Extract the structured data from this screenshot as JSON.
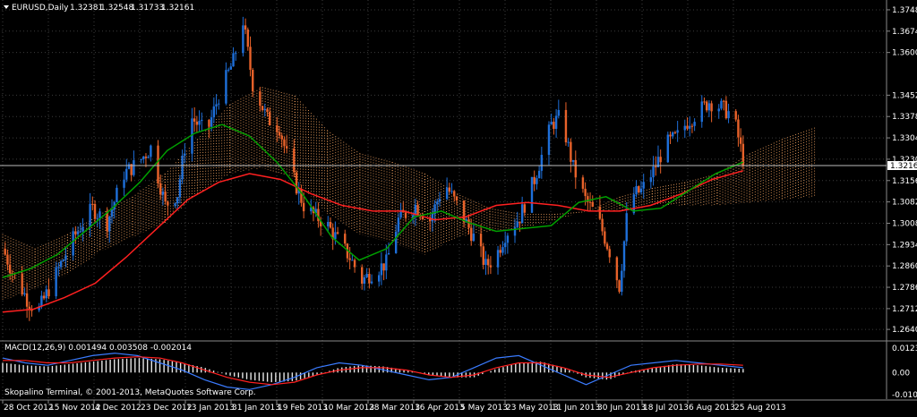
{
  "window": {
    "title": "EURUSD,Daily",
    "ohlc": [
      "1.32381",
      "1.32548",
      "1.31733",
      "1.32161"
    ],
    "current_price": "1.32161"
  },
  "indicator": {
    "title": "MACD(12,26,9) 0.001494 0.003508 -0.002014",
    "copyright": "Skopalino Terminal, © 2001-2013, MetaQuotes Software Corp."
  },
  "colors": {
    "background": "#000000",
    "bull": "#1e6fd9",
    "bear": "#e8622a",
    "ma_fast": "#00a000",
    "ma_slow": "#ff2020",
    "cloud": "#f4a460",
    "macd_main": "#3a7bff",
    "macd_signal": "#ff2020",
    "grid": "#3c3c3c"
  },
  "chart_data": {
    "type": "candlestick",
    "symbol": "EURUSD",
    "timeframe": "Daily",
    "price_axis": {
      "ylim": [
        1.26,
        1.3782
      ],
      "ticks": [
        "1.37480",
        "1.36740",
        "1.36000",
        "1.34520",
        "1.33780",
        "1.33040",
        "1.32300",
        "1.31560",
        "1.30820",
        "1.30080",
        "1.29340",
        "1.28600",
        "1.27860",
        "1.27120",
        "1.26400"
      ]
    },
    "x_labels": [
      "28 Oct 2012",
      "15 Nov 2012",
      "4 Dec 2012",
      "23 Dec 2012",
      "13 Jan 2013",
      "31 Jan 2013",
      "19 Feb 2013",
      "10 Mar 2013",
      "28 Mar 2013",
      "16 Apr 2013",
      "5 May 2013",
      "23 May 2013",
      "11 Jun 2013",
      "30 Jun 2013",
      "18 Jul 2013",
      "6 Aug 2013",
      "25 Aug 2013"
    ],
    "close_path": [
      [
        "28 Oct 2012",
        1.292
      ],
      [
        "1 Nov 2012",
        1.284
      ],
      [
        "8 Nov 2012",
        1.273
      ],
      [
        "12 Nov 2012",
        1.271
      ],
      [
        "20 Nov 2012",
        1.285
      ],
      [
        "27 Nov 2012",
        1.297
      ],
      [
        "4 Dec 2012",
        1.306
      ],
      [
        "10 Dec 2012",
        1.301
      ],
      [
        "17 Dec 2012",
        1.318
      ],
      [
        "23 Dec 2012",
        1.322
      ],
      [
        "28 Dec 2012",
        1.327
      ],
      [
        "3 Jan 2013",
        1.307
      ],
      [
        "8 Jan 2013",
        1.311
      ],
      [
        "13 Jan 2013",
        1.338
      ],
      [
        "20 Jan 2013",
        1.332
      ],
      [
        "25 Jan 2013",
        1.345
      ],
      [
        "31 Jan 2013",
        1.357
      ],
      [
        "4 Feb 2013",
        1.371
      ],
      [
        "8 Feb 2013",
        1.349
      ],
      [
        "14 Feb 2013",
        1.337
      ],
      [
        "19 Feb 2013",
        1.334
      ],
      [
        "24 Feb 2013",
        1.318
      ],
      [
        "1 Mar 2013",
        1.307
      ],
      [
        "6 Mar 2013",
        1.303
      ],
      [
        "10 Mar 2013",
        1.301
      ],
      [
        "15 Mar 2013",
        1.295
      ],
      [
        "20 Mar 2013",
        1.289
      ],
      [
        "25 Mar 2013",
        1.281
      ],
      [
        "28 Mar 2013",
        1.283
      ],
      [
        "4 Apr 2013",
        1.287
      ],
      [
        "9 Apr 2013",
        1.302
      ],
      [
        "16 Apr 2013",
        1.307
      ],
      [
        "22 Apr 2013",
        1.302
      ],
      [
        "28 Apr 2013",
        1.315
      ],
      [
        "5 May 2013",
        1.304
      ],
      [
        "10 May 2013",
        1.296
      ],
      [
        "15 May 2013",
        1.286
      ],
      [
        "19 May 2013",
        1.289
      ],
      [
        "23 May 2013",
        1.297
      ],
      [
        "29 May 2013",
        1.303
      ],
      [
        "4 Jun 2013",
        1.316
      ],
      [
        "11 Jun 2013",
        1.335
      ],
      [
        "15 Jun 2013",
        1.338
      ],
      [
        "20 Jun 2013",
        1.32
      ],
      [
        "25 Jun 2013",
        1.309
      ],
      [
        "30 Jun 2013",
        1.303
      ],
      [
        "5 Jul 2013",
        1.291
      ],
      [
        "9 Jul 2013",
        1.279
      ],
      [
        "13 Jul 2013",
        1.31
      ],
      [
        "18 Jul 2013",
        1.312
      ],
      [
        "23 Jul 2013",
        1.319
      ],
      [
        "28 Jul 2013",
        1.328
      ],
      [
        "2 Aug 2013",
        1.331
      ],
      [
        "6 Aug 2013",
        1.336
      ],
      [
        "10 Aug 2013",
        1.339
      ],
      [
        "15 Aug 2013",
        1.343
      ],
      [
        "20 Aug 2013",
        1.341
      ],
      [
        "25 Aug 2013",
        1.338
      ],
      [
        "29 Aug 2013",
        1.323
      ]
    ],
    "ma_fast": [
      1.282,
      1.285,
      1.29,
      1.298,
      1.306,
      1.315,
      1.326,
      1.332,
      1.335,
      1.331,
      1.322,
      1.31,
      1.296,
      1.288,
      1.292,
      1.303,
      1.305,
      1.301,
      1.298,
      1.299,
      1.3,
      1.308,
      1.31,
      1.305,
      1.306,
      1.312,
      1.318,
      1.322
    ],
    "ma_slow": [
      1.27,
      1.271,
      1.275,
      1.28,
      1.289,
      1.299,
      1.309,
      1.315,
      1.318,
      1.316,
      1.311,
      1.307,
      1.305,
      1.305,
      1.302,
      1.303,
      1.307,
      1.308,
      1.307,
      1.305,
      1.305,
      1.307,
      1.311,
      1.316,
      1.319
    ],
    "cloud_top": [
      1.297,
      1.292,
      1.297,
      1.304,
      1.31,
      1.318,
      1.33,
      1.342,
      1.348,
      1.345,
      1.333,
      1.325,
      1.322,
      1.318,
      1.311,
      1.306,
      1.304,
      1.304,
      1.305,
      1.31,
      1.313,
      1.315,
      1.318,
      1.325,
      1.33,
      1.334
    ],
    "cloud_bottom": [
      1.274,
      1.278,
      1.283,
      1.291,
      1.296,
      1.301,
      1.311,
      1.318,
      1.32,
      1.316,
      1.304,
      1.297,
      1.294,
      1.29,
      1.296,
      1.298,
      1.299,
      1.302,
      1.305,
      1.305,
      1.307,
      1.307,
      1.307,
      1.308,
      1.309,
      1.31
    ],
    "macd_panel": {
      "ylim": [
        -0.01097,
        0.01231
      ],
      "ticks": [
        "0.01231",
        "0.00",
        "-0.01097"
      ],
      "histogram": [
        0.004,
        0.003,
        0.0025,
        0.0035,
        0.0045,
        0.0055,
        0.006,
        0.0055,
        0.004,
        0.002,
        -0.001,
        -0.003,
        -0.004,
        -0.0035,
        -0.001,
        0.002,
        0.003,
        0.0025,
        0.001,
        -0.001,
        -0.002,
        -0.002,
        0.0015,
        0.004,
        0.0045,
        0.002,
        -0.002,
        -0.003,
        0.0005,
        0.002,
        0.0035,
        0.003,
        0.002,
        0.0015
      ],
      "macd_main": [
        0.006,
        0.004,
        0.003,
        0.005,
        0.007,
        0.008,
        0.007,
        0.004,
        0.001,
        -0.003,
        -0.006,
        -0.007,
        -0.005,
        -0.002,
        0.002,
        0.004,
        0.003,
        0.001,
        -0.001,
        -0.003,
        -0.002,
        0.002,
        0.006,
        0.007,
        0.003,
        -0.001,
        -0.005,
        -0.001,
        0.003,
        0.004,
        0.005,
        0.004,
        0.003,
        0.002
      ],
      "macd_signal": [
        0.005,
        0.005,
        0.004,
        0.004,
        0.005,
        0.006,
        0.0065,
        0.006,
        0.004,
        0.001,
        -0.002,
        -0.004,
        -0.005,
        -0.004,
        -0.001,
        0.001,
        0.002,
        0.002,
        0.001,
        -0.001,
        -0.002,
        -0.001,
        0.002,
        0.004,
        0.004,
        0.002,
        -0.001,
        -0.002,
        0.0,
        0.002,
        0.003,
        0.0035,
        0.0035,
        0.003
      ]
    }
  }
}
